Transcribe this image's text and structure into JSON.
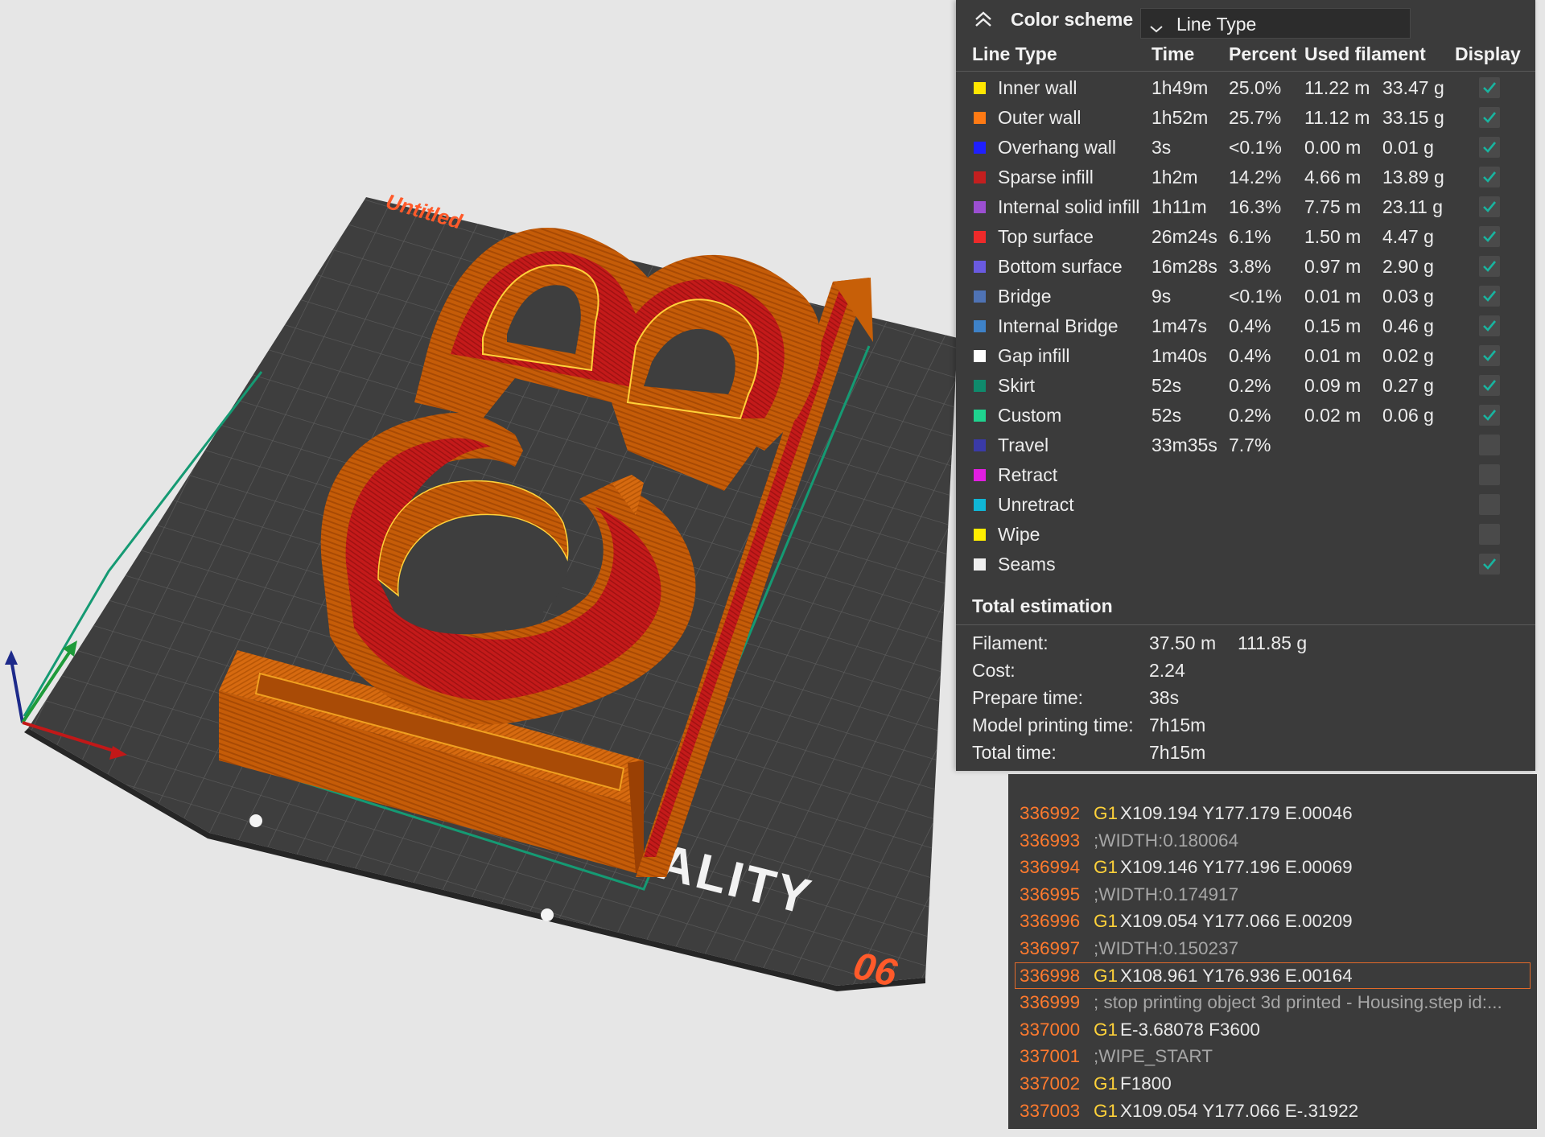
{
  "viewport": {
    "plate_title": "Untitled",
    "plate_brand": "ALITY",
    "plate_model": "06"
  },
  "legend": {
    "color_scheme_label": "Color scheme",
    "color_scheme_value": "Line Type",
    "columns": [
      "Line Type",
      "Time",
      "Percent",
      "Used filament",
      "Display"
    ],
    "rows": [
      {
        "name": "Inner wall",
        "time": "1h49m",
        "percent": "25.0%",
        "length": "11.22 m",
        "weight": "33.47 g",
        "color": "#ffe600",
        "display": true
      },
      {
        "name": "Outer wall",
        "time": "1h52m",
        "percent": "25.7%",
        "length": "11.12 m",
        "weight": "33.15 g",
        "color": "#ff7a14",
        "display": true
      },
      {
        "name": "Overhang wall",
        "time": "3s",
        "percent": "<0.1%",
        "length": "0.00 m",
        "weight": "0.01 g",
        "color": "#1f1fff",
        "display": true
      },
      {
        "name": "Sparse infill",
        "time": "1h2m",
        "percent": "14.2%",
        "length": "4.66 m",
        "weight": "13.89 g",
        "color": "#c31f1f",
        "display": true
      },
      {
        "name": "Internal solid infill",
        "time": "1h11m",
        "percent": "16.3%",
        "length": "7.75 m",
        "weight": "23.11 g",
        "color": "#9b4fd1",
        "display": true
      },
      {
        "name": "Top surface",
        "time": "26m24s",
        "percent": "6.1%",
        "length": "1.50 m",
        "weight": "4.47 g",
        "color": "#ee2a2a",
        "display": true
      },
      {
        "name": "Bottom surface",
        "time": "16m28s",
        "percent": "3.8%",
        "length": "0.97 m",
        "weight": "2.90 g",
        "color": "#6a5ae0",
        "display": true
      },
      {
        "name": "Bridge",
        "time": "9s",
        "percent": "<0.1%",
        "length": "0.01 m",
        "weight": "0.03 g",
        "color": "#4f73b5",
        "display": true
      },
      {
        "name": "Internal Bridge",
        "time": "1m47s",
        "percent": "0.4%",
        "length": "0.15 m",
        "weight": "0.46 g",
        "color": "#3e82c8",
        "display": true
      },
      {
        "name": "Gap infill",
        "time": "1m40s",
        "percent": "0.4%",
        "length": "0.01 m",
        "weight": "0.02 g",
        "color": "#ffffff",
        "display": true
      },
      {
        "name": "Skirt",
        "time": "52s",
        "percent": "0.2%",
        "length": "0.09 m",
        "weight": "0.27 g",
        "color": "#0f8a6c",
        "display": true
      },
      {
        "name": "Custom",
        "time": "52s",
        "percent": "0.2%",
        "length": "0.02 m",
        "weight": "0.06 g",
        "color": "#1fd38f",
        "display": true
      },
      {
        "name": "Travel",
        "time": "33m35s",
        "percent": "7.7%",
        "length": "",
        "weight": "",
        "color": "#3a3aa8",
        "display": false
      },
      {
        "name": "Retract",
        "time": "",
        "percent": "",
        "length": "",
        "weight": "",
        "color": "#e21ee2",
        "display": false
      },
      {
        "name": "Unretract",
        "time": "",
        "percent": "",
        "length": "",
        "weight": "",
        "color": "#10b6d6",
        "display": false
      },
      {
        "name": "Wipe",
        "time": "",
        "percent": "",
        "length": "",
        "weight": "",
        "color": "#ffee00",
        "display": false
      },
      {
        "name": "Seams",
        "time": "",
        "percent": "",
        "length": "",
        "weight": "",
        "color": "#f0f0f0",
        "display": true
      }
    ],
    "total_title": "Total estimation",
    "totals": [
      {
        "label": "Filament:",
        "v1": "37.50 m",
        "v2": "111.85 g"
      },
      {
        "label": "Cost:",
        "v1": "2.24",
        "v2": ""
      },
      {
        "label": "Prepare time:",
        "v1": "38s",
        "v2": ""
      },
      {
        "label": "Model printing time:",
        "v1": "7h15m",
        "v2": ""
      },
      {
        "label": "Total time:",
        "v1": "7h15m",
        "v2": ""
      }
    ]
  },
  "gcode": {
    "selected_line": "336998",
    "lines": [
      {
        "num": "336992",
        "cmd": "G1",
        "args": "X109.194 Y177.179 E.00046",
        "comment": ""
      },
      {
        "num": "336993",
        "cmd": "",
        "args": "",
        "comment": ";WIDTH:0.180064"
      },
      {
        "num": "336994",
        "cmd": "G1",
        "args": "X109.146 Y177.196 E.00069",
        "comment": ""
      },
      {
        "num": "336995",
        "cmd": "",
        "args": "",
        "comment": ";WIDTH:0.174917"
      },
      {
        "num": "336996",
        "cmd": "G1",
        "args": "X109.054 Y177.066 E.00209",
        "comment": ""
      },
      {
        "num": "336997",
        "cmd": "",
        "args": "",
        "comment": ";WIDTH:0.150237"
      },
      {
        "num": "336998",
        "cmd": "G1",
        "args": "X108.961 Y176.936 E.00164",
        "comment": ""
      },
      {
        "num": "336999",
        "cmd": "",
        "args": "",
        "comment": "; stop printing object 3d printed - Housing.step id:..."
      },
      {
        "num": "337000",
        "cmd": "G1",
        "args": "E-3.68078 F3600",
        "comment": ""
      },
      {
        "num": "337001",
        "cmd": "",
        "args": "",
        "comment": ";WIPE_START"
      },
      {
        "num": "337002",
        "cmd": "G1",
        "args": "F1800",
        "comment": ""
      },
      {
        "num": "337003",
        "cmd": "G1",
        "args": "X109.054 Y177.066 E-.31922",
        "comment": ""
      }
    ]
  }
}
